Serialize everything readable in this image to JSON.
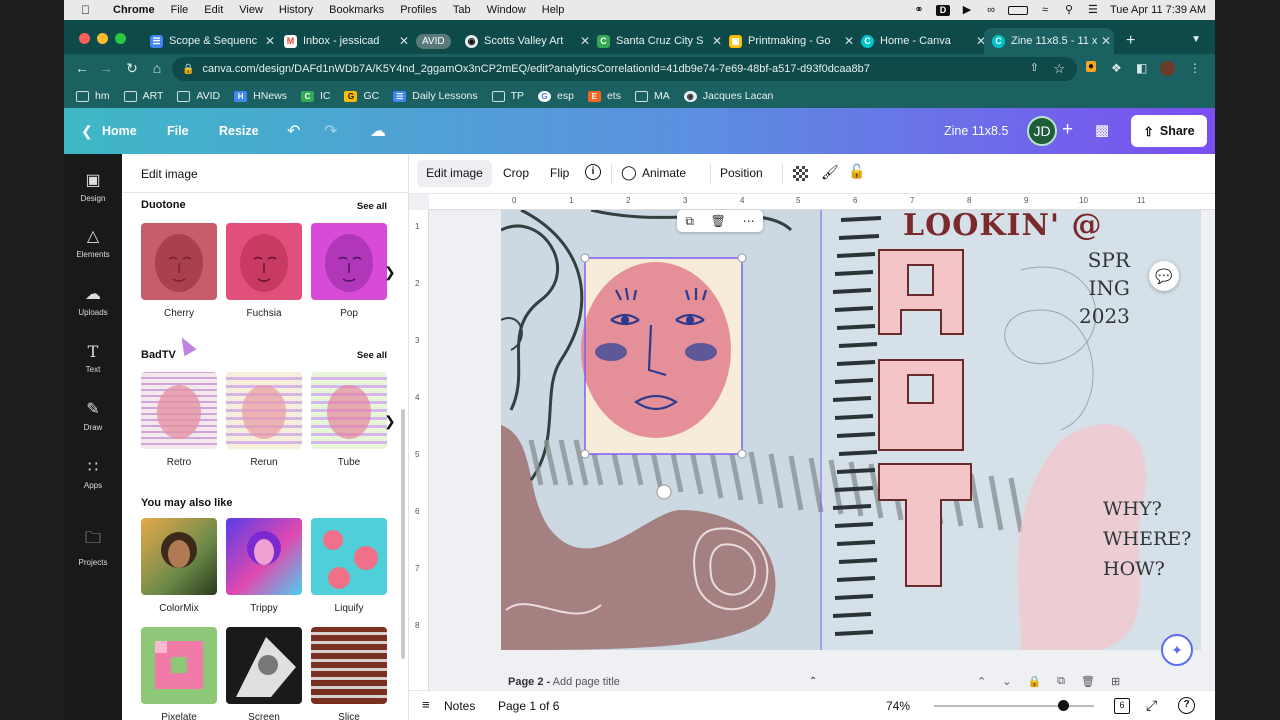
{
  "macbar": {
    "app": "Chrome",
    "menus": [
      "File",
      "Edit",
      "View",
      "History",
      "Bookmarks",
      "Profiles",
      "Tab",
      "Window",
      "Help"
    ],
    "clock": "Tue Apr 11  7:39 AM"
  },
  "tabs": [
    {
      "label": "Scope & Sequenc",
      "favicon_color": "#4285f4"
    },
    {
      "label": "Inbox - jessicad",
      "favicon_color": "#ea4335"
    },
    {
      "label": "AVID",
      "favicon_color": "#5a7a7a"
    },
    {
      "label": "Scotts Valley Art",
      "favicon_color": "#555555"
    },
    {
      "label": "Santa Cruz City S",
      "favicon_color": "#34a853"
    },
    {
      "label": "Printmaking - Go",
      "favicon_color": "#fbbc04"
    },
    {
      "label": "Home - Canva",
      "favicon_color": "#00c4cc"
    },
    {
      "label": "Zine 11x8.5 - 11 x",
      "favicon_color": "#00c4cc"
    }
  ],
  "address": {
    "url": "canva.com/design/DAFd1nWDb7A/K5Y4nd_2ggamOx3nCP2mEQ/edit?analyticsCorrelationId=41db9e74-7e69-48bf-a517-d93f0dcaa8b7"
  },
  "bookmarks": [
    {
      "label": "hm",
      "kind": "folder"
    },
    {
      "label": "ART",
      "kind": "folder"
    },
    {
      "label": "AVID",
      "kind": "folder"
    },
    {
      "label": "HNews",
      "kind": "site",
      "color": "#4285f4",
      "glyph": "H"
    },
    {
      "label": "IC",
      "kind": "site",
      "color": "#34a853",
      "glyph": "C"
    },
    {
      "label": "GC",
      "kind": "site",
      "color": "#fbbc04",
      "glyph": "G"
    },
    {
      "label": "Daily Lessons",
      "kind": "site",
      "color": "#4285f4",
      "glyph": "D"
    },
    {
      "label": "TP",
      "kind": "folder"
    },
    {
      "label": "esp",
      "kind": "site",
      "color": "#ffffff",
      "glyph": "G"
    },
    {
      "label": "ets",
      "kind": "site",
      "color": "#f26522",
      "glyph": "E"
    },
    {
      "label": "MA",
      "kind": "folder"
    },
    {
      "label": "Jacques Lacan",
      "kind": "site",
      "color": "#aaaaaa",
      "glyph": "J"
    }
  ],
  "header": {
    "home": "Home",
    "file": "File",
    "resize": "Resize",
    "title": "Zine 11x8.5",
    "avatar": "JD",
    "share": "Share"
  },
  "rail": [
    "Design",
    "Elements",
    "Uploads",
    "Text",
    "Draw",
    "Apps",
    "Projects"
  ],
  "panel": {
    "title": "Edit image",
    "see_all": "See all",
    "duotone": {
      "heading": "Duotone",
      "items": [
        "Cherry",
        "Fuchsia",
        "Pop"
      ]
    },
    "badtv": {
      "heading": "BadTV",
      "items": [
        "Retro",
        "Rerun",
        "Tube"
      ]
    },
    "also": {
      "heading": "You may also like",
      "items": [
        "ColorMix",
        "Trippy",
        "Liquify",
        "Pixelate",
        "Screen",
        "Slice"
      ]
    }
  },
  "canvas_toolbar": {
    "edit_image": "Edit image",
    "crop": "Crop",
    "flip": "Flip",
    "animate": "Animate",
    "position": "Position"
  },
  "ruler": {
    "h": [
      "0",
      "1",
      "2",
      "3",
      "4",
      "5",
      "6",
      "7",
      "8",
      "9",
      "10",
      "11"
    ],
    "v": [
      "1",
      "2",
      "3",
      "4",
      "5",
      "6",
      "7",
      "8"
    ]
  },
  "artwork": {
    "title_partial": "LOOKIN' @",
    "art": "ART",
    "season": [
      "SPR",
      "ING",
      "2023"
    ],
    "questions": [
      "WHY?",
      "WHERE?",
      "HOW?"
    ]
  },
  "page": {
    "label": "Page 2 -",
    "placeholder": "Add page title"
  },
  "bottom": {
    "notes": "Notes",
    "page_of": "Page 1 of 6",
    "zoom": "74%",
    "zoom_fraction": 0.74,
    "page_count": "6"
  },
  "colors": {
    "canva_gradient_start": "#3fb8c6",
    "canva_gradient_end": "#7b4ff0",
    "chrome_teal": "#1c6161",
    "selection": "#7d5cf5"
  }
}
